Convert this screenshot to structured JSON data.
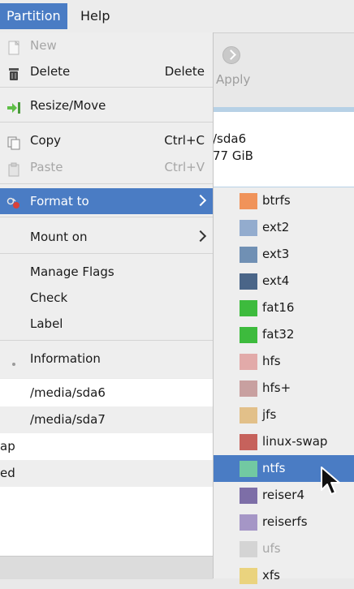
{
  "menubar": {
    "partition": "Partition",
    "help": "Help"
  },
  "toolbar": {
    "apply": "Apply"
  },
  "diskmap": {
    "line1": "/sda6",
    "line2": "77 GiB"
  },
  "partition_menu": {
    "new": "New",
    "delete": "Delete",
    "delete_accel": "Delete",
    "resize": "Resize/Move",
    "copy": "Copy",
    "copy_accel": "Ctrl+C",
    "paste": "Paste",
    "paste_accel": "Ctrl+V",
    "format_to": "Format to",
    "mount_on": "Mount on",
    "manage_flags": "Manage Flags",
    "check": "Check",
    "label": "Label",
    "information": "Information"
  },
  "partition_list": {
    "row1": "/media/sda6",
    "row2": "/media/sda7",
    "row3": "ap",
    "row4": "ed"
  },
  "format_submenu": {
    "items": [
      {
        "name": "btrfs",
        "color": "#f0935a"
      },
      {
        "name": "ext2",
        "color": "#93acce"
      },
      {
        "name": "ext3",
        "color": "#7090b4"
      },
      {
        "name": "ext4",
        "color": "#4a6588"
      },
      {
        "name": "fat16",
        "color": "#3dbb3d"
      },
      {
        "name": "fat32",
        "color": "#3dbb3d"
      },
      {
        "name": "hfs",
        "color": "#e2aaa9"
      },
      {
        "name": "hfs+",
        "color": "#c8a0a0"
      },
      {
        "name": "jfs",
        "color": "#e2c089"
      },
      {
        "name": "linux-swap",
        "color": "#c6625c"
      },
      {
        "name": "ntfs",
        "color": "#72c9a2"
      },
      {
        "name": "reiser4",
        "color": "#7d6ea7"
      },
      {
        "name": "reiserfs",
        "color": "#a596c6"
      },
      {
        "name": "ufs",
        "color": "#d4d4d4"
      },
      {
        "name": "xfs",
        "color": "#ead37e"
      }
    ]
  },
  "colors": {
    "accent": "#4a7cc4",
    "menu_bg": "#eeeeee",
    "disabled": "#a6a6a6"
  }
}
